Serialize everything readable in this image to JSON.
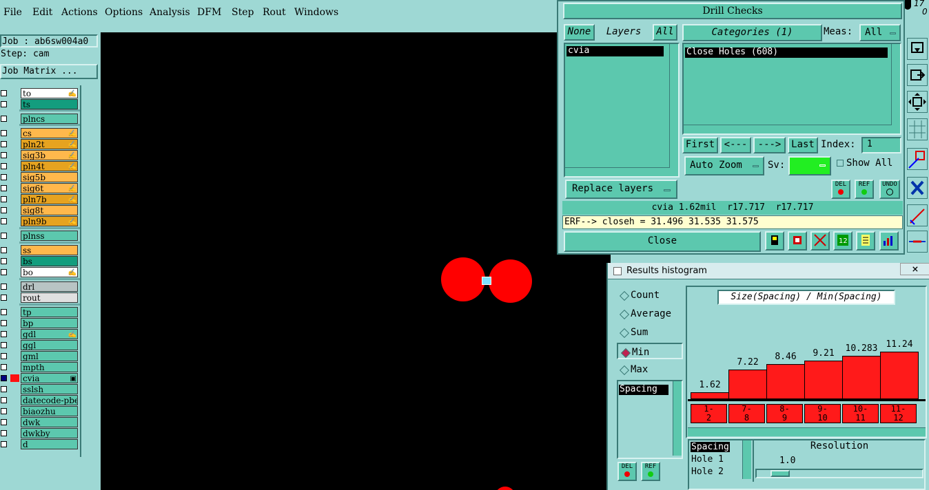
{
  "menu": [
    "File",
    "Edit",
    "Actions",
    "Options",
    "Analysis",
    "DFM",
    "Step",
    "Rout",
    "Windows"
  ],
  "job": {
    "job": "Job : ab6sw004a0",
    "step": "Step: cam",
    "matrix_button": "Job Matrix ..."
  },
  "layers": [
    {
      "name": "to",
      "color": "#ffffff",
      "flag": "✍"
    },
    {
      "name": "ts",
      "color": "#139d7e",
      "flag": ""
    },
    {
      "name": "plncs",
      "color": "#5cc8ae",
      "flag": ""
    },
    {
      "name": "cs",
      "color": "#ffb84c",
      "flag": "✍"
    },
    {
      "name": "pln2t",
      "color": "#e6a320",
      "flag": "✍"
    },
    {
      "name": "sig3b",
      "color": "#ffb84c",
      "flag": "✍"
    },
    {
      "name": "pln4t",
      "color": "#e6a320",
      "flag": "✍"
    },
    {
      "name": "sig5b",
      "color": "#ffb84c",
      "flag": ""
    },
    {
      "name": "sig6t",
      "color": "#ffb84c",
      "flag": "✍"
    },
    {
      "name": "pln7b",
      "color": "#e6a320",
      "flag": "✍"
    },
    {
      "name": "sig8t",
      "color": "#ffb84c",
      "flag": ""
    },
    {
      "name": "pln9b",
      "color": "#e6a320",
      "flag": "✍"
    },
    {
      "name": "plnss",
      "color": "#5cc8ae",
      "flag": ""
    },
    {
      "name": "ss",
      "color": "#ffb84c",
      "flag": ""
    },
    {
      "name": "bs",
      "color": "#139d7e",
      "flag": ""
    },
    {
      "name": "bo",
      "color": "#ffffff",
      "flag": "✍"
    },
    {
      "name": "drl",
      "color": "#b8c4c4",
      "flag": ""
    },
    {
      "name": "rout",
      "color": "#e0e0e0",
      "flag": ""
    },
    {
      "name": "tp",
      "color": "#5cc8ae",
      "flag": ""
    },
    {
      "name": "bp",
      "color": "#5cc8ae",
      "flag": ""
    },
    {
      "name": "gdl",
      "color": "#5cc8ae",
      "flag": "✍"
    },
    {
      "name": "ggl",
      "color": "#5cc8ae",
      "flag": ""
    },
    {
      "name": "gml",
      "color": "#5cc8ae",
      "flag": ""
    },
    {
      "name": "mpth",
      "color": "#5cc8ae",
      "flag": ""
    },
    {
      "name": "cvia",
      "color": "#5cc8ae",
      "flag": "▣"
    },
    {
      "name": "sslsh",
      "color": "#5cc8ae",
      "flag": ""
    },
    {
      "name": "datecode-pbe",
      "color": "#5cc8ae",
      "flag": ""
    },
    {
      "name": "biaozhu",
      "color": "#5cc8ae",
      "flag": ""
    },
    {
      "name": "dwk",
      "color": "#5cc8ae",
      "flag": ""
    },
    {
      "name": "dwkby",
      "color": "#5cc8ae",
      "flag": ""
    },
    {
      "name": "d",
      "color": "#5cc8ae",
      "flag": ""
    }
  ],
  "drill": {
    "title": "Drill Checks",
    "none_btn": "None",
    "layers_label": "Layers",
    "all_btn": "All",
    "layer_selected": "cvia",
    "categories_label": "Categories (1)",
    "meas_label": "Meas:",
    "meas_value": "All",
    "category_item": "Close Holes (608)",
    "first_btn": "First",
    "prev_btn": "<---",
    "next_btn": "--->",
    "last_btn": "Last",
    "index_label": "Index:",
    "index_value": "1",
    "auto_zoom": "Auto Zoom",
    "sv_label": "Sv:",
    "sv_color": "#22ee22",
    "show_all": "Show All",
    "replace_layers": "Replace layers",
    "del": "DEL",
    "ref": "REF",
    "undo": "UNDO",
    "status": "cvia 1.62mil  r17.717  r17.717",
    "erf": "ERF--> closeh = 31.496 31.535 31.575",
    "close_btn": "Close"
  },
  "histogram": {
    "title": "Results histogram",
    "modes": [
      "Count",
      "Average",
      "Sum",
      "Min",
      "Max"
    ],
    "selected_mode": "Min",
    "list_selected": "Spacing",
    "chart_title": "Size(Spacing) / Min(Spacing)",
    "resolution_label": "Resolution",
    "resolution_value": "1.0",
    "legend": [
      "Spacing",
      "Hole 1",
      "Hole 2"
    ],
    "del": "DEL",
    "ref": "REF",
    "close_x": "×"
  },
  "chart_data": {
    "type": "bar",
    "title": "Size(Spacing) / Min(Spacing)",
    "categories": [
      "1-2",
      "7-8",
      "8-9",
      "9-10",
      "10-11",
      "11-12"
    ],
    "values": [
      1.62,
      7.22,
      8.46,
      9.21,
      10.283,
      11.24
    ],
    "ylim": [
      0,
      12.5
    ],
    "bar_color": "#ff1a1a"
  },
  "clock": {
    "top": "17",
    "bottom": "0"
  }
}
